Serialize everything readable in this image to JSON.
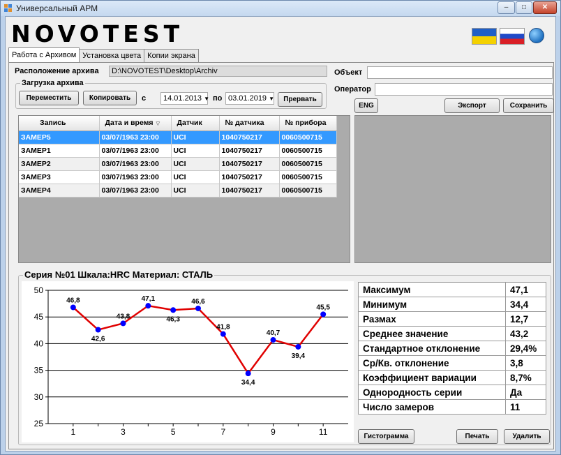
{
  "window": {
    "title": "Универсальный АРМ",
    "logo": "NOVOTEST",
    "controls": {
      "minimize": "–",
      "maximize": "□",
      "close": "✕"
    }
  },
  "icons": {
    "app": "app-icon",
    "flag_ua": "ukraine-flag-icon",
    "flag_ru": "russia-flag-icon",
    "language": "globe-icon"
  },
  "tabs": [
    {
      "label": "Работа с Архивом",
      "active": true
    },
    {
      "label": "Установка цвета",
      "active": false
    },
    {
      "label": "Копии экрана",
      "active": false
    }
  ],
  "archive": {
    "location_label": "Расположение архива",
    "location_value": "D:\\NOVOTEST\\Desktop\\Archiv",
    "object_label": "Объект",
    "object_value": "",
    "operator_label": "Оператор",
    "operator_value": ""
  },
  "load": {
    "group_label": "Загрузка архива",
    "move_button": "Переместить",
    "copy_button": "Копировать",
    "from_label": "с",
    "from_date": "14.01.2013",
    "to_label": "по",
    "to_date": "03.01.2019",
    "stop_button": "Прервать"
  },
  "actions": {
    "eng_button": "ENG",
    "export_button": "Экспорт",
    "save_button": "Сохранить"
  },
  "records_table": {
    "columns": [
      "Запись",
      "Дата и время",
      "Датчик",
      "№ датчика",
      "№ прибора"
    ],
    "rows": [
      [
        "ЗАМЕР5",
        "03/07/1963 23:00",
        "UCI",
        "1040750217",
        "0060500715"
      ],
      [
        "ЗАМЕР1",
        "03/07/1963 23:00",
        "UCI",
        "1040750217",
        "0060500715"
      ],
      [
        "ЗАМЕР2",
        "03/07/1963 23:00",
        "UCI",
        "1040750217",
        "0060500715"
      ],
      [
        "ЗАМЕР3",
        "03/07/1963 23:00",
        "UCI",
        "1040750217",
        "0060500715"
      ],
      [
        "ЗАМЕР4",
        "03/07/1963 23:00",
        "UCI",
        "1040750217",
        "0060500715"
      ]
    ],
    "selected_row": 0
  },
  "series": {
    "title": "Серия №01 Шкала:HRC Материал: СТАЛЬ",
    "stats": [
      {
        "label": "Максимум",
        "value": "47,1"
      },
      {
        "label": "Минимум",
        "value": "34,4"
      },
      {
        "label": "Размах",
        "value": "12,7"
      },
      {
        "label": "Среднее значение",
        "value": "43,2"
      },
      {
        "label": "Стандартное отклонение",
        "value": "29,4%"
      },
      {
        "label": "Ср/Кв. отклонение",
        "value": "3,8"
      },
      {
        "label": "Коэффициент вариации",
        "value": "8,7%"
      },
      {
        "label": "Однородность серии",
        "value": "Да"
      },
      {
        "label": "Число замеров",
        "value": "11"
      }
    ],
    "histogram_button": "Гистограмма",
    "print_button": "Печать",
    "delete_button": "Удалить"
  },
  "chart_data": {
    "type": "line",
    "x": [
      1,
      2,
      3,
      4,
      5,
      6,
      7,
      8,
      9,
      10,
      11
    ],
    "series": [
      {
        "values": [
          46.8,
          42.6,
          43.8,
          47.1,
          46.3,
          46.6,
          41.8,
          34.4,
          40.7,
          39.4,
          45.5
        ],
        "color": "#e00000",
        "marker_color": "#0000ff"
      }
    ],
    "data_labels": [
      "46,8",
      "42,6",
      "43,8",
      "47,1",
      "46,3",
      "46,6",
      "41,8",
      "34,4",
      "40,7",
      "39,4",
      "45,5"
    ],
    "xticks": [
      1,
      3,
      5,
      7,
      9,
      11
    ],
    "yticks": [
      25,
      30,
      35,
      40,
      45,
      50
    ],
    "xlim": [
      0,
      12
    ],
    "ylim": [
      25,
      50
    ],
    "grid": "y",
    "title": "",
    "xlabel": "",
    "ylabel": ""
  }
}
